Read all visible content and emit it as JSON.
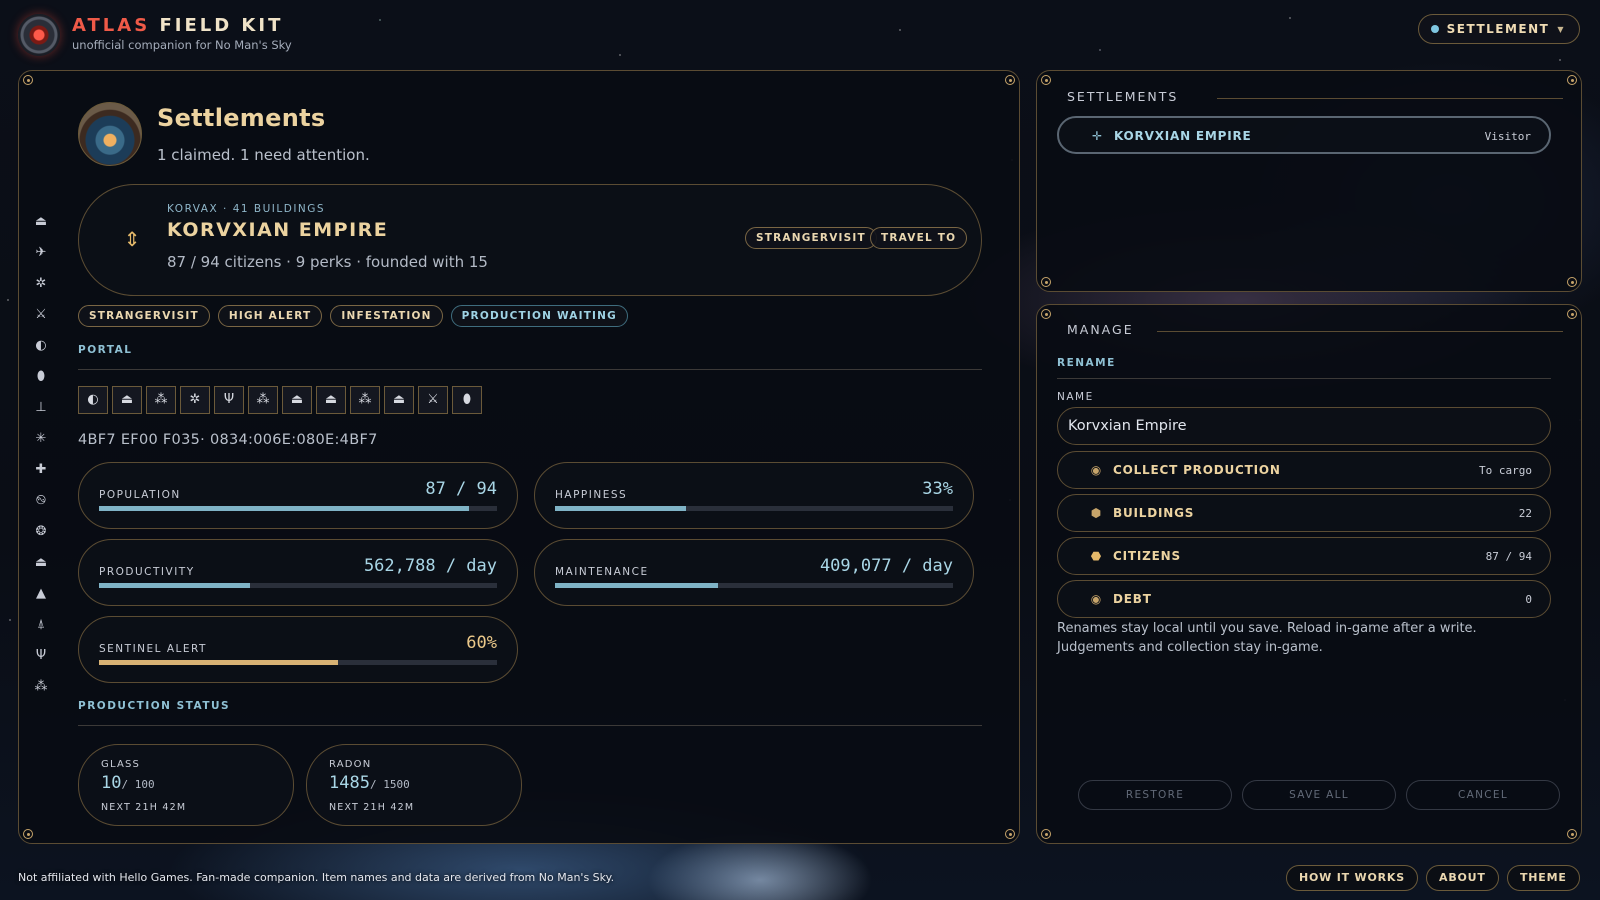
{
  "brand": {
    "part1": "ATLAS",
    "part2": "FIELD KIT",
    "tagline": "unofficial companion for No Man's Sky"
  },
  "mode": {
    "label": "SETTLEMENT"
  },
  "sidebar_icons": [
    "ship",
    "fighter",
    "sentinel",
    "sword",
    "globe",
    "pod",
    "freighter",
    "bug",
    "drone",
    "spiral",
    "orb",
    "shuttle",
    "rocket",
    "interceptor",
    "antenna",
    "tree"
  ],
  "main": {
    "title": "Settlements",
    "subtitle": "1 claimed. 1 need attention.",
    "card": {
      "meta": "KORVAX · 41 BUILDINGS",
      "name": "KORVXIAN EMPIRE",
      "stats": "87 / 94 citizens · 9 perks · founded with 15",
      "action1": "STRANGERVISIT",
      "action2": "TRAVEL TO"
    },
    "tags": [
      "STRANGERVISIT",
      "HIGH ALERT",
      "INFESTATION",
      "PRODUCTION WAITING"
    ],
    "portal_label": "PORTAL",
    "portal_glyphs": [
      "sunset",
      "bird",
      "face",
      "diplo",
      "eclipse",
      "balloon",
      "boat",
      "bug",
      "dragonfly",
      "galaxy",
      "voxel",
      "whale"
    ],
    "address": "4BF7 EF00 F035· 0834:006E:080E:4BF7",
    "stats": {
      "population": {
        "label": "POPULATION",
        "value": "87 / 94",
        "fraction": 0.93
      },
      "happiness": {
        "label": "HAPPINESS",
        "value": "33%",
        "fraction": 0.33
      },
      "productivity": {
        "label": "PRODUCTIVITY",
        "value": "562,788 / day",
        "fraction": 0.38
      },
      "maintenance": {
        "label": "MAINTENANCE",
        "value": "409,077 / day",
        "fraction": 0.41
      },
      "sentinel": {
        "label": "SENTINEL ALERT",
        "value": "60%",
        "fraction": 0.6
      }
    },
    "production_label": "PRODUCTION STATUS",
    "production": [
      {
        "resource": "GLASS",
        "amount": "10",
        "max": "/ 100",
        "eta": "NEXT 21H 42M"
      },
      {
        "resource": "RADON",
        "amount": "1485",
        "max": "/ 1500",
        "eta": "NEXT 21H 42M"
      }
    ]
  },
  "settlements_panel": {
    "title": "SETTLEMENTS",
    "items": [
      {
        "name": "KORVXIAN EMPIRE",
        "role": "Visitor"
      }
    ]
  },
  "manage": {
    "title": "MANAGE",
    "rename_label": "RENAME",
    "name_label": "NAME",
    "name_value": "Korvxian Empire",
    "rows": [
      {
        "name": "COLLECT PRODUCTION",
        "value": "To cargo"
      },
      {
        "name": "BUILDINGS",
        "value": "22"
      },
      {
        "name": "CITIZENS",
        "value": "87 / 94"
      },
      {
        "name": "DEBT",
        "value": "0"
      }
    ],
    "note": "Renames stay local until you save. Reload in-game after a write. Judgements and collection stay in-game.",
    "restore": "RESTORE",
    "save_all": "SAVE ALL",
    "cancel": "CANCEL"
  },
  "footer": {
    "disclaimer": "Not affiliated with Hello Games. Fan-made companion. Item names and data are derived from No Man's Sky.",
    "how_it_works": "HOW IT WORKS",
    "about": "ABOUT",
    "theme": "THEME"
  },
  "colors": {
    "accent_gold": "#ecd3a0",
    "accent_teal": "#8fc1d4",
    "brand_red": "#ef5a48",
    "panel_border": "#5b4c33"
  }
}
